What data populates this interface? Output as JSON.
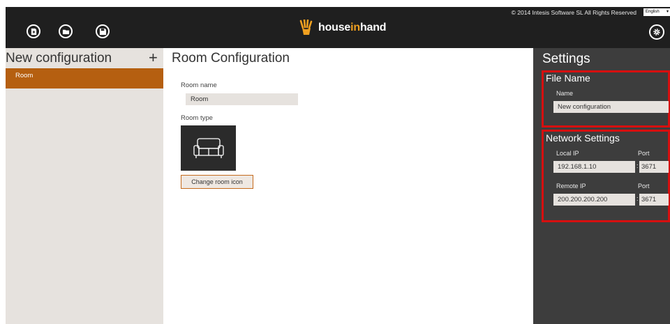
{
  "topbar": {
    "logo_text_part1": "house",
    "logo_text_part2": "in",
    "logo_text_part3": "hand",
    "copyright": "© 2014 Intesis Software SL All Rights Reserved",
    "language": "English",
    "buttons": [
      {
        "icon": "new-file-icon"
      },
      {
        "icon": "open-folder-icon"
      },
      {
        "icon": "save-icon"
      }
    ],
    "settings_icon": "gear-icon"
  },
  "sidebar": {
    "title": "New configuration",
    "add_label": "+",
    "items": [
      {
        "label": "Room",
        "selected": true
      }
    ]
  },
  "main": {
    "title": "Room Configuration",
    "room_name_label": "Room name",
    "room_name_value": "Room",
    "room_type_label": "Room type",
    "room_type_icon": "sofa-icon",
    "change_icon_label": "Change room icon"
  },
  "settings": {
    "title": "Settings",
    "file_name": {
      "section_title": "File Name",
      "name_label": "Name",
      "name_value": "New configuration"
    },
    "network": {
      "section_title": "Network Settings",
      "local_ip_label": "Local IP",
      "local_ip_value": "192.168.1.10",
      "local_port_label": "Port",
      "local_port_value": "3671",
      "remote_ip_label": "Remote IP",
      "remote_ip_value": "200.200.200.200",
      "remote_port_label": "Port",
      "remote_port_value": "3671",
      "separator": ":"
    }
  },
  "colors": {
    "accent": "#b55f10",
    "topbar": "#1f1f1f",
    "panel": "#e6e2de",
    "settings_bg": "#3d3d3d",
    "highlight_box": "#d60f0f",
    "logo_accent": "#f0a020"
  }
}
